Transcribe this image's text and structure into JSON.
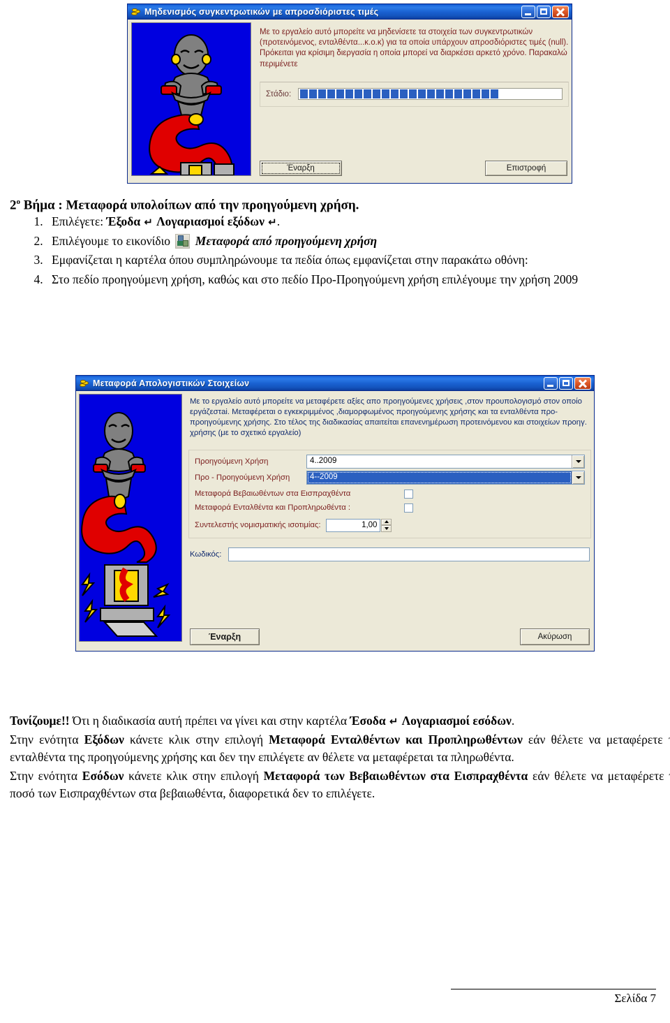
{
  "dialog_zero": {
    "title": "Μηδενισμός συγκεντρωτικών με απροσδιόριστες τιμές",
    "title_icon": "coins-icon",
    "description": "Με το εργαλείο αυτό μπορείτε να μηδενίσετε τα στοιχεία των συγκεντρωτικών (προτεινόμενος, ενταλθέντα...κ.ο.κ) για τα οποία υπάρχουν απροσδιόριστες τιμές (null). Πρόκειται για κρίσιμη διεργασία η οποία μπορεί να διαρκέσει αρκετό χρόνο. Παρακαλώ περιμένετε",
    "stage_label": "Στάδιο:",
    "progress_segments": 22,
    "start_button": "Έναρξη",
    "back_button": "Επιστροφή",
    "caption_buttons": {
      "minimize": "minimize-icon",
      "maximize": "maximize-icon",
      "close": "close-icon"
    }
  },
  "document": {
    "heading_prefix": "2",
    "heading_sup": "ο",
    "heading_rest": " Βήμα : Μεταφορά υπολοίπων από την προηγούμενη χρήση.",
    "steps": [
      {
        "number": "1.",
        "parts": [
          {
            "t": "Επιλέγετε: ",
            "s": "normal"
          },
          {
            "t": "Έξοδα",
            "s": "bold"
          },
          {
            "t": " ↵ ",
            "s": "glyph"
          },
          {
            "t": "Λογαριασμοί εξόδων",
            "s": "bold"
          },
          {
            "t": " ↵",
            "s": "glyph"
          },
          {
            "t": ".",
            "s": "normal"
          }
        ]
      },
      {
        "number": "2.",
        "parts": [
          {
            "t": "Επιλέγουμε το εικονίδιο ",
            "s": "normal"
          },
          {
            "t": "ICON",
            "s": "icon"
          },
          {
            "t": " Μεταφορά από προηγούμενη χρήση",
            "s": "bolditalic"
          }
        ]
      },
      {
        "number": "3.",
        "parts": [
          {
            "t": "Εμφανίζεται η καρτέλα όπου συμπληρώνουμε τα πεδία όπως εμφανίζεται στην παρακάτω οθόνη:",
            "s": "normal"
          }
        ]
      },
      {
        "number": "4.",
        "parts": [
          {
            "t": "Στο πεδίο προηγούμενη χρήση, καθώς και στο πεδίο Προ-Προηγούμενη χρήση επιλέγουμε την χρήση 2009",
            "s": "normal"
          }
        ]
      }
    ]
  },
  "dialog_transfer": {
    "title": "Μεταφορά Απολογιστικών Στοιχείων",
    "title_icon": "coins-icon",
    "description": "Με το εργαλείο αυτό μπορείτε να μεταφέρετε αξίες απο προηγούμενες χρήσεις ,στον προυπολογισμό στον οποίο εργάζεστai. Μεταφέρεται ο εγκεκριμμένος ,διαμορφωμένος προηγούμενης χρήσης και τα ενταλθέντα προ-προηγούμενης χρήσης. Στο τέλος της διαδικασίας απαιτείται επανενημέρωση προτεινόμενου και στοιχείων προηγ. χρήσης (με το σχετικό εργαλείο)",
    "fields": {
      "prev_year_label": "Προηγούμενη Χρήση",
      "prev_year_value": "4..2009",
      "pre_prev_year_label": "Προ - Προηγούμενη Χρήση",
      "pre_prev_year_value": "4--2009",
      "check1_label": "Μεταφορά Βεβαιωθέντων στα Εισπραχθέντα",
      "check1_checked": false,
      "check2_label": "Μεταφορά Ενταλθέντα και Προπληρωθέντα :",
      "check2_checked": false,
      "rate_label": "Συντελεστής νομισματικής ισοτιμίας:",
      "rate_value": "1,00",
      "code_label": "Κωδικός:",
      "code_value": ""
    },
    "start_button": "Έναρξη",
    "cancel_button": "Ακύρωση",
    "caption_buttons": {
      "minimize": "minimize-icon",
      "maximize": "maximize-icon",
      "close": "close-icon"
    }
  },
  "notes": {
    "p1": [
      {
        "t": "Τονίζουμε!!",
        "s": "bold"
      },
      {
        "t": " Ότι η διαδικασία αυτή πρέπει να γίνει και στην καρτέλα ",
        "s": "normal"
      },
      {
        "t": "Έσοδα",
        "s": "bold"
      },
      {
        "t": " ↵ ",
        "s": "glyph"
      },
      {
        "t": "Λογαριασμοί εσόδων",
        "s": "bold"
      },
      {
        "t": ".",
        "s": "normal"
      }
    ],
    "p2": [
      {
        "t": "Στην ενότητα ",
        "s": "normal"
      },
      {
        "t": "Εξόδων",
        "s": "bold"
      },
      {
        "t": " κάνετε κλικ στην επιλογή ",
        "s": "normal"
      },
      {
        "t": "Μεταφορά Ενταλθέντων και Προπληρωθέντων",
        "s": "bold"
      },
      {
        "t": " εάν θέλετε να μεταφέρετε τα ενταλθέντα της προηγούμενης χρήσης και δεν την επιλέγετε αν θέλετε να μεταφέρεται τα πληρωθέντα.",
        "s": "normal"
      }
    ],
    "p3": [
      {
        "t": "Στην ενότητα ",
        "s": "normal"
      },
      {
        "t": "Εσόδων",
        "s": "bold"
      },
      {
        "t": " κάνετε κλικ στην επιλογή ",
        "s": "normal"
      },
      {
        "t": "Μεταφορά των Βεβαιωθέντων στα Εισπραχθέντα",
        "s": "bold"
      },
      {
        "t": " εάν θέλετε να μεταφέρετε το ποσό των Εισπραχθέντων στα βεβαιωθέντα, διαφορετικά δεν το επιλέγετε.",
        "s": "normal"
      }
    ]
  },
  "footer": {
    "page_label": "Σελίδα 7"
  },
  "colors": {
    "titlebar_blue": "#1960d0",
    "dialog_face": "#ece9d8",
    "desc_red": "#7c2020",
    "desc_navy": "#102a6e",
    "progress_blue": "#2a5fc0",
    "select_blue": "#2a5fc0",
    "genie_bg": "#0000e0",
    "genie_body": "#808080",
    "genie_tail": "#e00000",
    "genie_gold": "#ffd800"
  }
}
